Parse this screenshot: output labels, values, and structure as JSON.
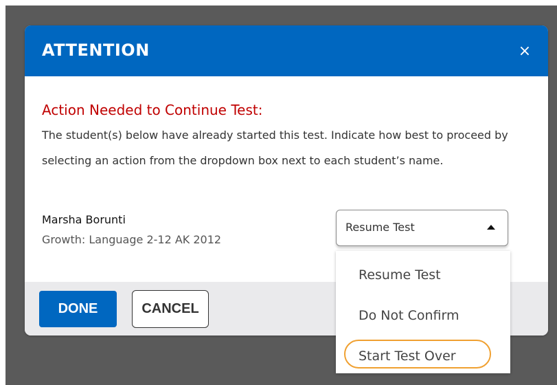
{
  "modal": {
    "title": "ATTENTION",
    "close_symbol": "×",
    "alert_heading": "Action Needed to Continue Test:",
    "message": "The student(s) below have already started this test. Indicate how best to proceed by selecting an action from the dropdown box next to each student’s name."
  },
  "student": {
    "name": "Marsha Borunti",
    "test": "Growth: Language 2-12 AK 2012"
  },
  "action_select": {
    "selected": "Resume Test",
    "options": [
      "Resume Test",
      "Do Not Confirm",
      "Start Test Over"
    ],
    "highlighted_option": "Start Test Over"
  },
  "footer": {
    "done_label": "DONE",
    "cancel_label": "CANCEL"
  },
  "colors": {
    "header_blue": "#0067c0",
    "alert_red": "#c00000",
    "highlight_orange": "#f0a030",
    "backdrop": "#5a5a5a"
  },
  "icons": {
    "close": "close-icon",
    "caret": "caret-up-icon"
  }
}
